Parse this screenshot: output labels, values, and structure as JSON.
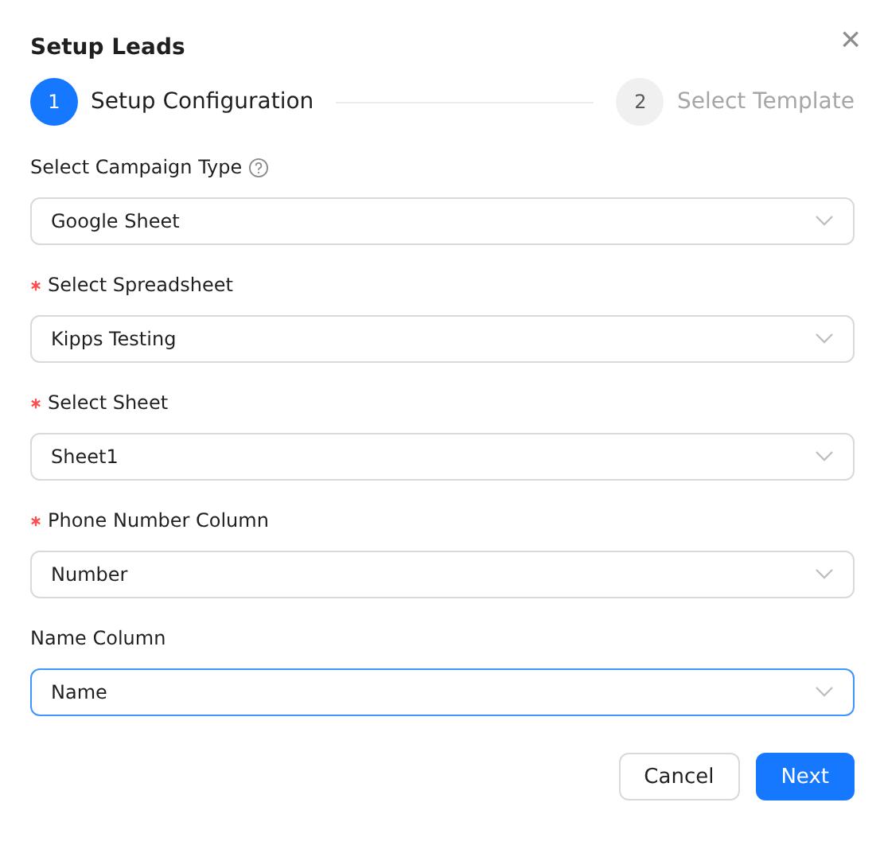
{
  "dialog": {
    "title": "Setup Leads",
    "close": "×"
  },
  "steps": [
    {
      "number": "1",
      "label": "Setup Configuration",
      "selected": true
    },
    {
      "number": "2",
      "label": "Select Template",
      "selected": false
    }
  ],
  "fields": [
    {
      "label": "Select Campaign Type",
      "required": false,
      "help": true,
      "value": "Google Sheet",
      "focused": false
    },
    {
      "label": "Select Spreadsheet",
      "required": true,
      "help": false,
      "value": "Kipps Testing",
      "focused": false
    },
    {
      "label": "Select Sheet",
      "required": true,
      "help": false,
      "value": "Sheet1",
      "focused": false
    },
    {
      "label": "Phone Number Column",
      "required": true,
      "help": false,
      "value": "Number",
      "focused": false
    },
    {
      "label": "Name Column",
      "required": false,
      "help": false,
      "value": "Name",
      "focused": true
    }
  ],
  "buttons": [
    {
      "label": "Cancel",
      "kind": "default"
    },
    {
      "label": "Next",
      "kind": "primary"
    }
  ]
}
